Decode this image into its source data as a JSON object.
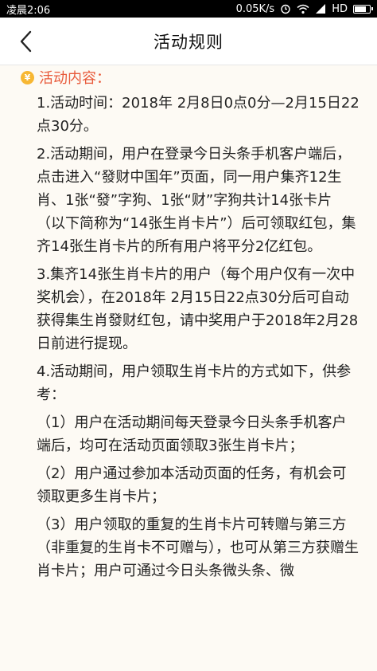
{
  "status_bar": {
    "time": "凌晨2:06",
    "network_speed": "0.05K/s",
    "network_type": "HD"
  },
  "nav": {
    "title": "活动规则"
  },
  "section": {
    "title": "活动内容："
  },
  "paragraphs": [
    "1.活动时间：2018年 2月8日0点0分—2月15日22点30分。",
    "2.活动期间，用户在登录今日头条手机客户端后，点击进入“發财中国年”页面，同一用户集齐12生肖、1张“發”字狗、1张“财”字狗共计14张卡片（以下简称为“14张生肖卡片”）后可领取红包，集齐14张生肖卡片的所有用户将平分2亿红包。",
    "3.集齐14张生肖卡片的用户（每个用户仅有一次中奖机会），在2018年 2月15日22点30分后可自动获得集生肖發财红包，请中奖用户于2018年2月28日前进行提现。",
    "4.活动期间，用户领取生肖卡片的方式如下，供参考：",
    "（1）用户在活动期间每天登录今日头条手机客户端后，均可在活动页面领取3张生肖卡片；",
    "（2）用户通过参加本活动页面的任务，有机会可领取更多生肖卡片；",
    "（3）用户领取的重复的生肖卡片可转赠与第三方（非重复的生肖卡不可赠与），也可从第三方获赠生肖卡片；用户可通过今日头条微头条、微"
  ],
  "colors": {
    "accent": "#e85a3b",
    "coin": "#f7b733",
    "background": "#fdfaf4"
  },
  "icons": {
    "back": "chevron-left-icon",
    "coin": "yuan-coin-icon"
  }
}
